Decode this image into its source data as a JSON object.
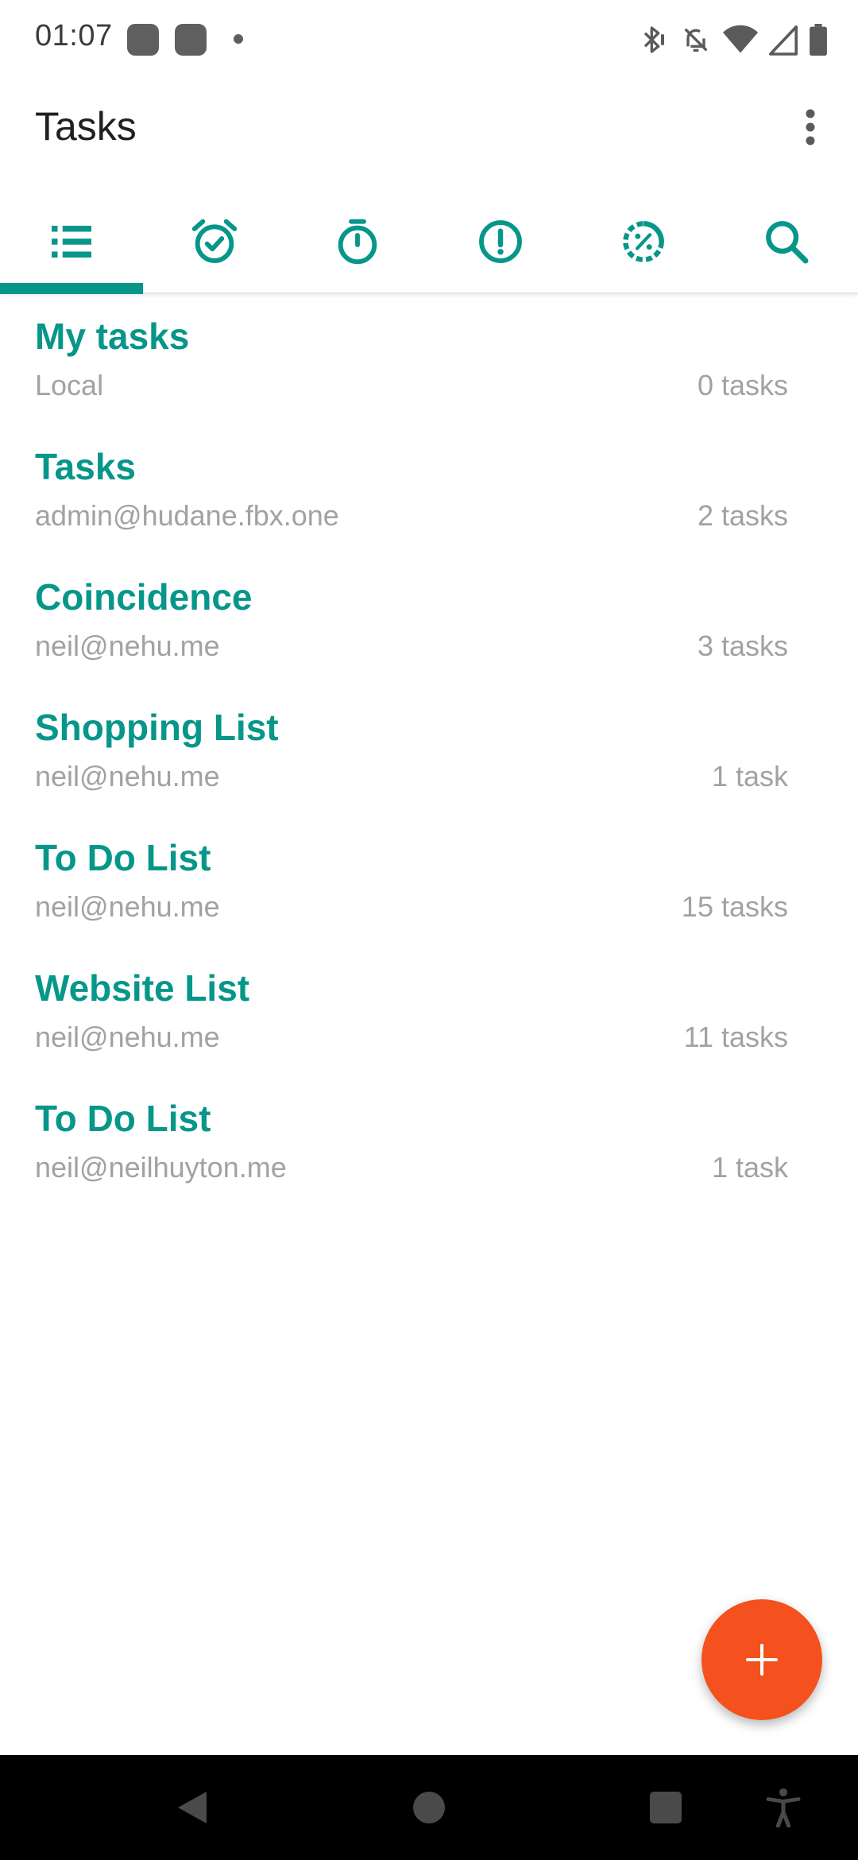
{
  "status_bar": {
    "time": "01:07",
    "icons": [
      "bluetooth-icon",
      "notifications-off-icon",
      "wifi-icon",
      "signal-icon",
      "battery-icon"
    ]
  },
  "app_bar": {
    "title": "Tasks",
    "overflow_icon": "more-vert-icon"
  },
  "tabs": [
    {
      "icon": "list-icon",
      "selected": true
    },
    {
      "icon": "alarm-check-icon",
      "selected": false
    },
    {
      "icon": "timer-icon",
      "selected": false
    },
    {
      "icon": "priority-icon",
      "selected": false
    },
    {
      "icon": "progress-percent-icon",
      "selected": false
    },
    {
      "icon": "search-icon",
      "selected": false
    }
  ],
  "lists": [
    {
      "name": "My tasks",
      "account": "Local",
      "count": "0 tasks"
    },
    {
      "name": "Tasks",
      "account": "admin@hudane.fbx.one",
      "count": "2 tasks"
    },
    {
      "name": "Coincidence",
      "account": "neil@nehu.me",
      "count": "3 tasks"
    },
    {
      "name": "Shopping List",
      "account": "neil@nehu.me",
      "count": "1 task"
    },
    {
      "name": "To Do List",
      "account": "neil@nehu.me",
      "count": "15 tasks"
    },
    {
      "name": "Website List",
      "account": "neil@nehu.me",
      "count": "11 tasks"
    },
    {
      "name": "To Do List",
      "account": "neil@neilhuyton.me",
      "count": "1 task"
    }
  ],
  "fab": {
    "icon": "add-icon"
  },
  "nav_bar": {
    "icons": [
      "back-icon",
      "home-icon",
      "recents-icon",
      "accessibility-icon"
    ]
  },
  "colors": {
    "accent": "#06968a",
    "fab": "#f4511e",
    "secondary_text": "#a2a2a2",
    "title_text": "#202020"
  }
}
